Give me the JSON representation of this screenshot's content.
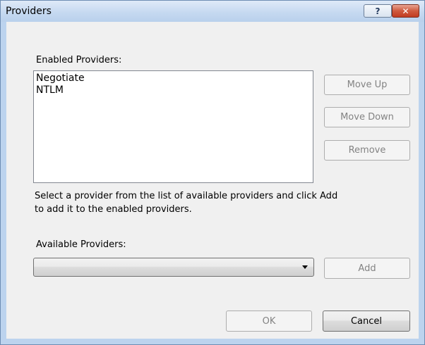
{
  "window": {
    "title": "Providers",
    "help_button": "?",
    "close_button": "✕"
  },
  "enabled": {
    "label": "Enabled Providers:",
    "items": [
      "Negotiate",
      "NTLM"
    ]
  },
  "buttons": {
    "move_up": "Move Up",
    "move_down": "Move Down",
    "remove": "Remove",
    "add": "Add",
    "ok": "OK",
    "cancel": "Cancel"
  },
  "instructions": {
    "line1": "Select a provider from the list of available providers and click Add",
    "line2": "to add it to the enabled providers."
  },
  "available": {
    "label": "Available Providers:",
    "selected": ""
  },
  "colors": {
    "titlebar": "#c4d8f0",
    "close_button": "#c94a30",
    "dialog_background": "#f0f0f0"
  }
}
